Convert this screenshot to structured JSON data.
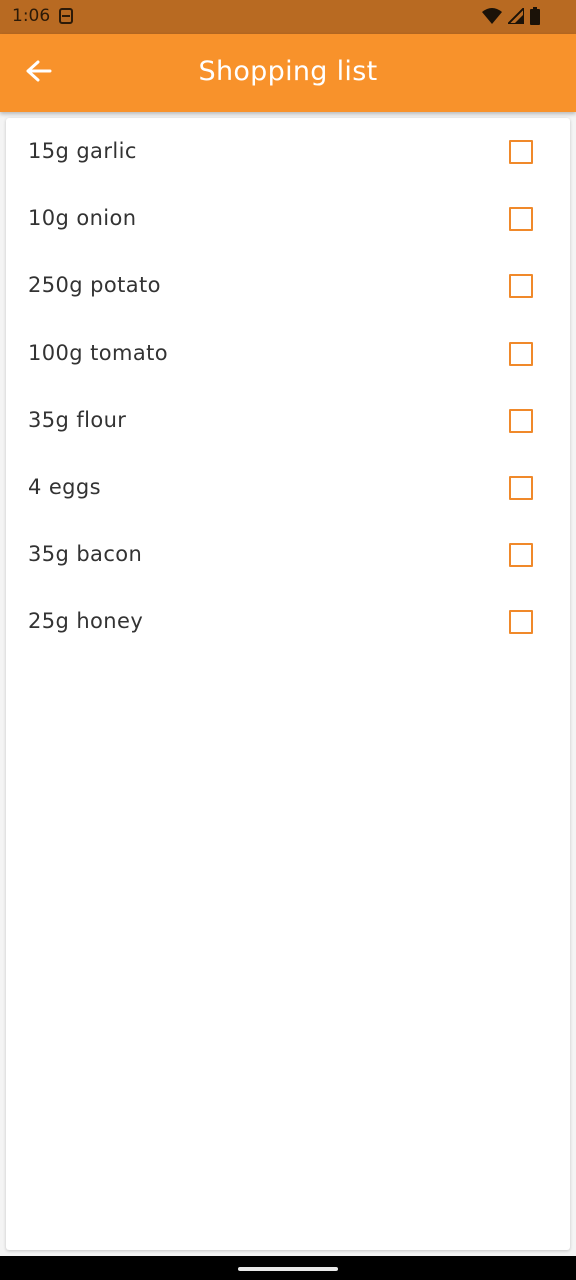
{
  "status_bar": {
    "time": "1:06"
  },
  "app_bar": {
    "title": "Shopping list"
  },
  "colors": {
    "accent": "#f8922b",
    "status_bar": "#b86a22",
    "checkbox_border": "#f0892a"
  },
  "items": [
    {
      "label": "15g garlic",
      "checked": false
    },
    {
      "label": "10g onion",
      "checked": false
    },
    {
      "label": "250g potato",
      "checked": false
    },
    {
      "label": "100g tomato",
      "checked": false
    },
    {
      "label": "35g flour",
      "checked": false
    },
    {
      "label": "4 eggs",
      "checked": false
    },
    {
      "label": "35g bacon",
      "checked": false
    },
    {
      "label": "25g honey",
      "checked": false
    }
  ]
}
